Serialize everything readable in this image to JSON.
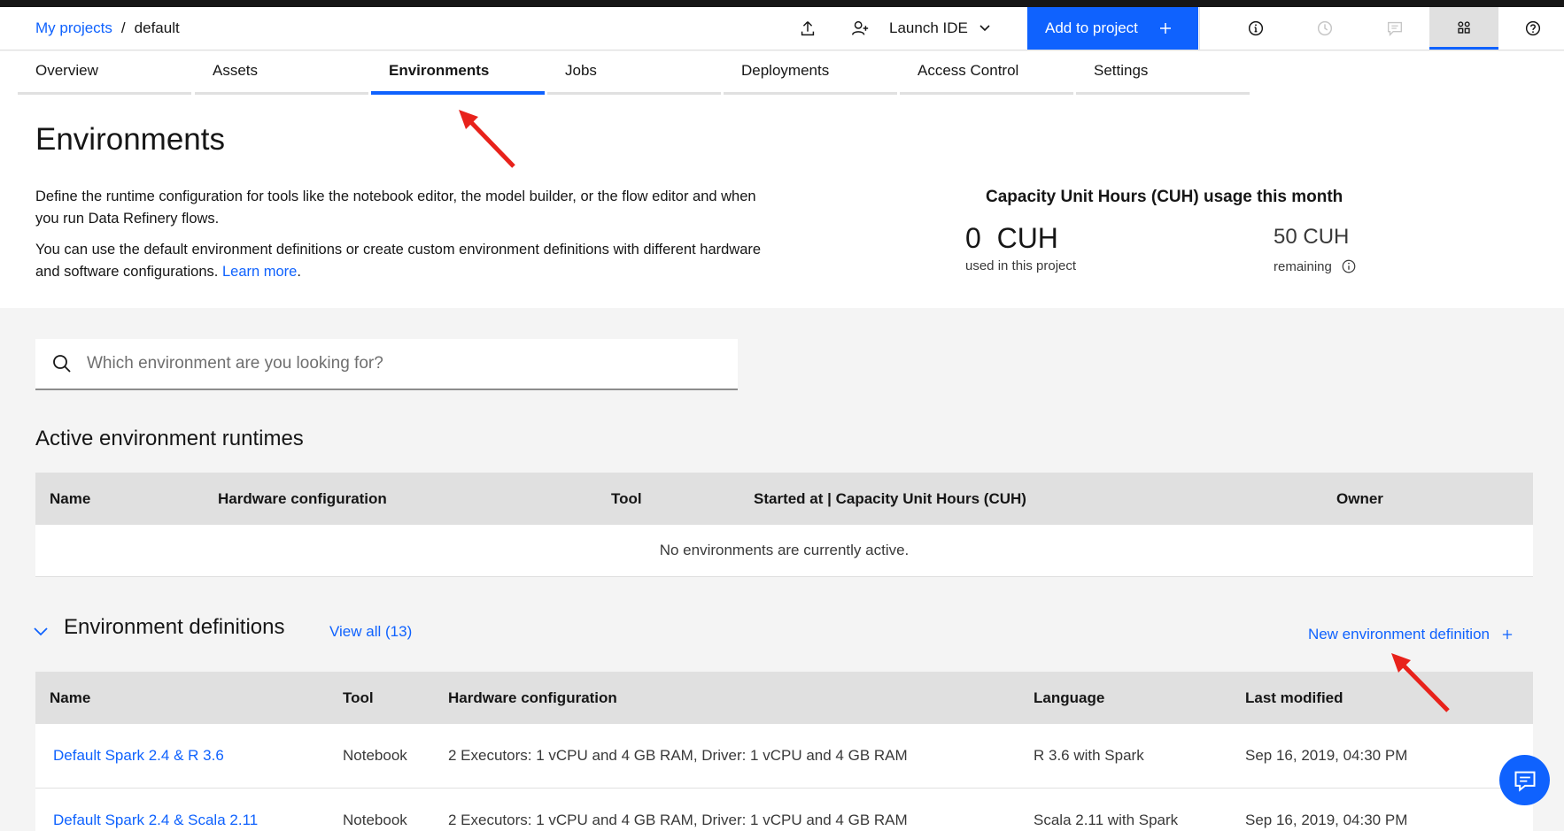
{
  "header": {
    "breadcrumb": {
      "root": "My projects",
      "separator": "/",
      "current": "default"
    },
    "launch_ide": "Launch IDE",
    "add_to_project": "Add to project"
  },
  "tabs": [
    {
      "label": "Overview"
    },
    {
      "label": "Assets"
    },
    {
      "label": "Environments",
      "active": true
    },
    {
      "label": "Jobs"
    },
    {
      "label": "Deployments"
    },
    {
      "label": "Access Control"
    },
    {
      "label": "Settings"
    }
  ],
  "page": {
    "title": "Environments",
    "desc1": "Define the runtime configuration for tools like the notebook editor, the model builder, or the flow editor and when you run Data Refinery flows.",
    "desc2_text": "You can use the default environment definitions or create custom environment definitions with different hardware and software configurations. ",
    "desc2_link": "Learn more",
    "desc2_end": "."
  },
  "cuh": {
    "title": "Capacity Unit Hours (CUH) usage this month",
    "used": "0  CUH",
    "used_label": "used in this project",
    "remaining": "50 CUH",
    "remaining_label": "remaining"
  },
  "search": {
    "placeholder": "Which environment are you looking for?"
  },
  "active_runtimes": {
    "title": "Active environment runtimes",
    "columns": [
      "Name",
      "Hardware configuration",
      "Tool",
      "Started at | Capacity Unit Hours (CUH)",
      "Owner"
    ],
    "empty": "No environments are currently active."
  },
  "env_defs": {
    "title": "Environment definitions",
    "view_all": "View all (13)",
    "new_label": "New environment definition",
    "columns": [
      "Name",
      "Tool",
      "Hardware configuration",
      "Language",
      "Last modified"
    ],
    "rows": [
      {
        "name": "Default Spark 2.4 & R 3.6",
        "tool": "Notebook",
        "hardware": "2 Executors: 1 vCPU and 4 GB RAM, Driver: 1 vCPU and 4 GB RAM",
        "language": "R 3.6 with Spark",
        "modified": "Sep 16, 2019, 04:30 PM"
      },
      {
        "name": "Default Spark 2.4 & Scala 2.11",
        "tool": "Notebook",
        "hardware": "2 Executors: 1 vCPU and 4 GB RAM, Driver: 1 vCPU and 4 GB RAM",
        "language": "Scala 2.11 with Spark",
        "modified": "Sep 16, 2019, 04:30 PM"
      }
    ]
  },
  "colors": {
    "accent": "#0f62fe",
    "annotation_arrow": "#e8221b"
  }
}
